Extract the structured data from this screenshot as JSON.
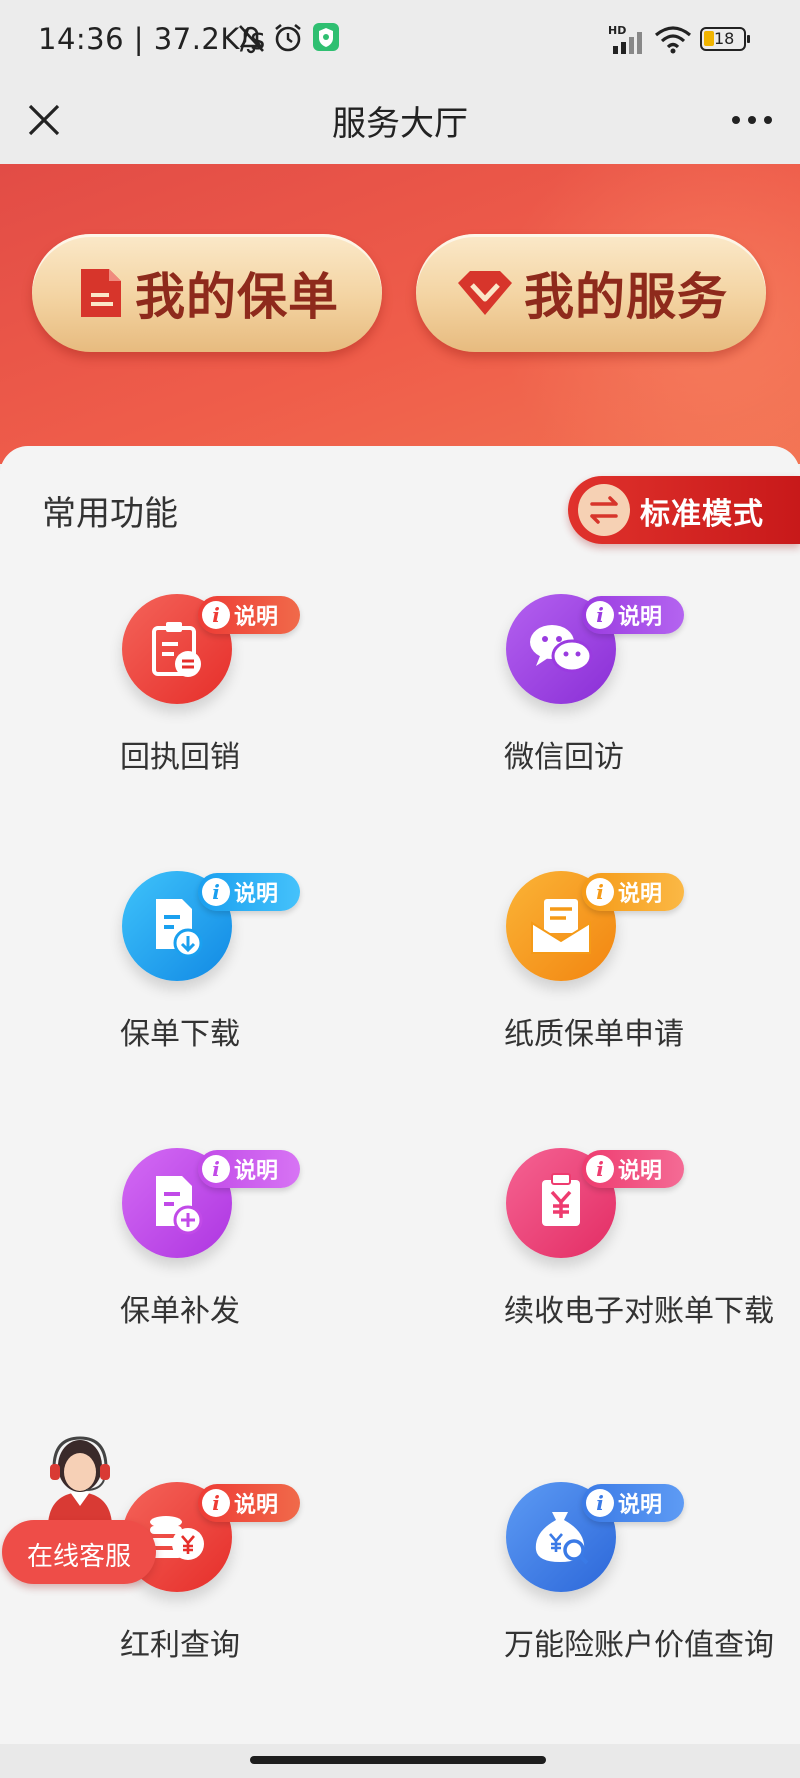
{
  "status_bar": {
    "time": "14:36",
    "speed": "37.2K/s",
    "battery": "18",
    "network_badge": "HD"
  },
  "nav": {
    "title": "服务大厅"
  },
  "banner": {
    "policy_label": "我的保单",
    "service_label": "我的服务"
  },
  "section": {
    "title": "常用功能",
    "mode_label": "标准模式"
  },
  "badge_text": "说明",
  "badge_icon": "i",
  "items": [
    {
      "label": "回执回销",
      "icon": "receipt-icon",
      "color": "#ee3b35"
    },
    {
      "label": "微信回访",
      "icon": "wechat-icon",
      "color": "#9a3be0"
    },
    {
      "label": "保单下载",
      "icon": "download-doc-icon",
      "color": "#1aa0ef"
    },
    {
      "label": "纸质保单申请",
      "icon": "envelope-letter-icon",
      "color": "#f59a17"
    },
    {
      "label": "保单补发",
      "icon": "doc-add-icon",
      "color": "#c14ae8"
    },
    {
      "label": "续收电子对账单下载",
      "icon": "yuan-tag-icon",
      "color": "#ee3b6f"
    },
    {
      "label": "红利查询",
      "icon": "coins-icon",
      "color": "#ee3b35"
    },
    {
      "label": "万能险账户价值查询",
      "icon": "money-bag-search-icon",
      "color": "#3a7ae6"
    }
  ],
  "float_service": {
    "label": "在线客服"
  }
}
